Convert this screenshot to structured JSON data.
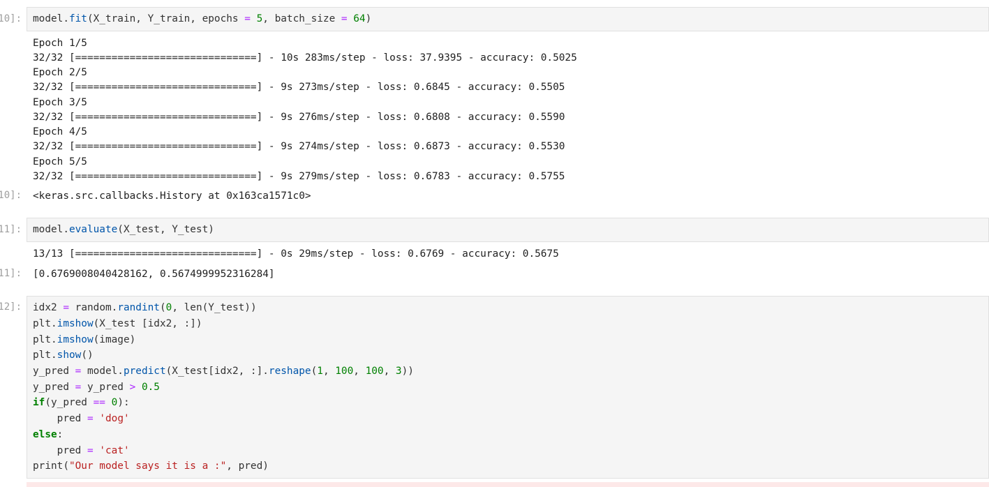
{
  "cells": {
    "c10": {
      "in_prompt": "10]:",
      "out_prompt": "10]:",
      "code": {
        "obj": "model.",
        "fn": "fit",
        "args1": "(X_train, Y_train, epochs ",
        "eq1": "=",
        "sp1": " ",
        "n5": "5",
        "args2": ", batch_size ",
        "eq2": "=",
        "sp2": " ",
        "n64": "64",
        "close": ")"
      },
      "stream": [
        "Epoch 1/5",
        "32/32 [==============================] - 10s 283ms/step - loss: 37.9395 - accuracy: 0.5025",
        "Epoch 2/5",
        "32/32 [==============================] - 9s 273ms/step - loss: 0.6845 - accuracy: 0.5505",
        "Epoch 3/5",
        "32/32 [==============================] - 9s 276ms/step - loss: 0.6808 - accuracy: 0.5590",
        "Epoch 4/5",
        "32/32 [==============================] - 9s 274ms/step - loss: 0.6873 - accuracy: 0.5530",
        "Epoch 5/5",
        "32/32 [==============================] - 9s 279ms/step - loss: 0.6783 - accuracy: 0.5755"
      ],
      "result": "<keras.src.callbacks.History at 0x163ca1571c0>"
    },
    "c11": {
      "in_prompt": "11]:",
      "out_prompt": "11]:",
      "code": {
        "obj": "model.",
        "fn": "evaluate",
        "args": "(X_test, Y_test)"
      },
      "stream": "13/13 [==============================] - 0s 29ms/step - loss: 0.6769 - accuracy: 0.5675",
      "result": "[0.6769008040428162, 0.5674999952316284]"
    },
    "c12": {
      "in_prompt": "12]:",
      "code_lines": {
        "l1": {
          "a": "idx2 ",
          "eq": "=",
          "b": " random.",
          "fn": "randint",
          "c": "(",
          "n0": "0",
          "d": ", len(Y_test))"
        },
        "l2": {
          "a": "plt.",
          "fn": "imshow",
          "b": "(X_test [idx2, :])"
        },
        "l3": {
          "a": "plt.",
          "fn": "imshow",
          "b": "(image)"
        },
        "l4": {
          "a": "plt.",
          "fn": "show",
          "b": "()"
        },
        "l5": {
          "a": "y_pred ",
          "eq": "=",
          "b": " model.",
          "fn": "predict",
          "c": "(X_test[idx2, :].",
          "fn2": "reshape",
          "d": "(",
          "n1": "1",
          "e": ", ",
          "n100a": "100",
          "f": ", ",
          "n100b": "100",
          "g": ", ",
          "n3": "3",
          "h": "))"
        },
        "l6": {
          "a": "y_pred ",
          "eq": "=",
          "b": " y_pred ",
          "gt": ">",
          "sp": " ",
          "num": "0.5"
        },
        "l7": {
          "kw": "if",
          "a": "(y_pred ",
          "eqeq": "==",
          "sp": " ",
          "n0": "0",
          "b": "):"
        },
        "l8": {
          "indent": "    ",
          "a": "pred ",
          "eq": "=",
          "sp": " ",
          "str": "'dog'"
        },
        "l9": {
          "kw": "else",
          "a": ":"
        },
        "l10": {
          "indent": "    ",
          "a": "pred ",
          "eq": "=",
          "sp": " ",
          "str": "'cat'"
        },
        "l11": {
          "a": "print(",
          "str": "\"Our model says it is a :\"",
          "b": ", pred)"
        }
      }
    }
  }
}
